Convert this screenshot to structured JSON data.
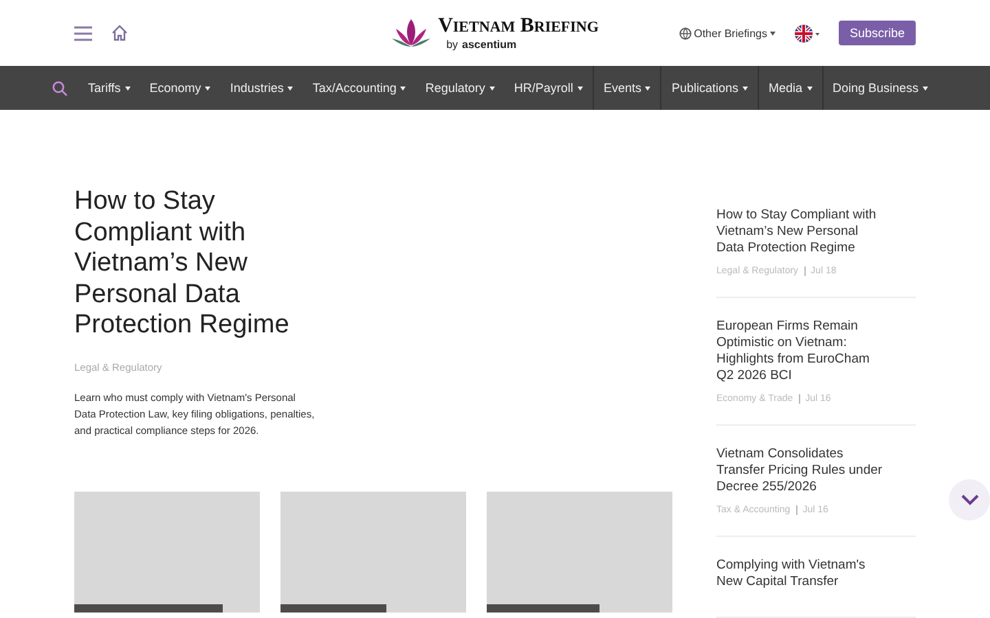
{
  "header": {
    "logo_title": "Vietnam Briefing",
    "logo_by": "by",
    "logo_brand": "ascentium",
    "other_briefings": "Other Briefings",
    "subscribe": "Subscribe"
  },
  "nav": [
    {
      "label": "Tariffs",
      "has_menu": true
    },
    {
      "label": "Economy",
      "has_menu": true
    },
    {
      "label": "Industries",
      "has_menu": true
    },
    {
      "label": "Tax/Accounting",
      "has_menu": true
    },
    {
      "label": "Regulatory",
      "has_menu": true
    },
    {
      "label": "HR/Payroll",
      "has_menu": true
    },
    {
      "label": "Events",
      "has_menu": true
    },
    {
      "label": "Publications",
      "has_menu": true
    },
    {
      "label": "Media",
      "has_menu": true
    },
    {
      "label": "Doing Business",
      "has_menu": true
    }
  ],
  "feature": {
    "title": "How to Stay Compliant with Vietnam’s New Personal Data Protection Regime",
    "category": "Legal & Regulatory",
    "summary": "Learn who must comply with Vietnam's Personal Data Protection Law, key filing obligations, penalties, and practical compliance steps for 2026."
  },
  "cards": [
    {
      "kind": "placeholder"
    },
    {
      "kind": "placeholder"
    },
    {
      "kind": "placeholder"
    }
  ],
  "sidebar": [
    {
      "title": "How to Stay Compliant with Vietnam’s New Personal Data Protection Regime",
      "category": "Legal & Regulatory",
      "date": "Jul 18"
    },
    {
      "title": "European Firms Remain Optimistic on Vietnam: Highlights from EuroCham Q2 2026 BCI",
      "category": "Economy & Trade",
      "date": "Jul 16"
    },
    {
      "title": "Vietnam Consolidates Transfer Pricing Rules under Decree 255/2026",
      "category": "Tax & Accounting",
      "date": "Jul 16"
    },
    {
      "title": "Complying with Vietnam's New Capital Transfer"
    }
  ]
}
